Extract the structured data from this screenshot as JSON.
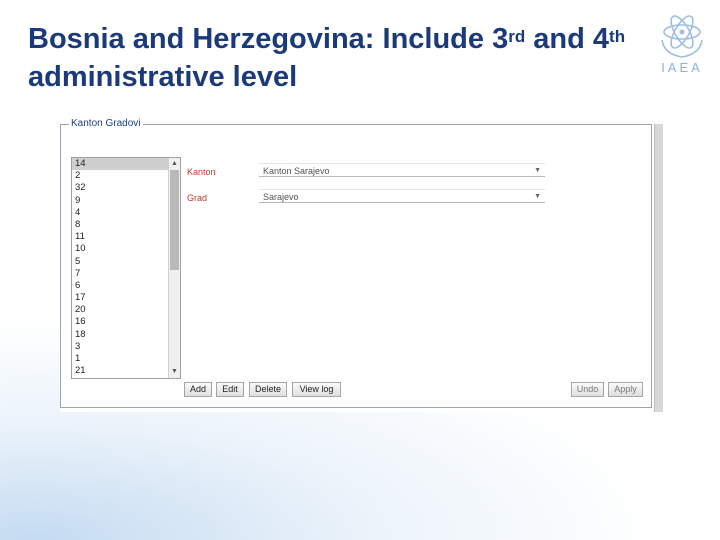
{
  "slide": {
    "title_prefix": "Bosnia and Herzegovina: Include 3",
    "title_sup1": "rd",
    "title_mid": " and 4",
    "title_sup2": "th",
    "title_suffix": " administrative level",
    "logo_text": "IAEA"
  },
  "panel": {
    "legend": "Kanton Gradovi",
    "list_items": [
      "14",
      "2",
      "32",
      "9",
      "4",
      "8",
      "11",
      "10",
      "5",
      "7",
      "6",
      "17",
      "20",
      "16",
      "18",
      "3",
      "1",
      "21"
    ],
    "selected_index": 0,
    "kanton_label": "Kanton",
    "kanton_value": "Kanton Sarajevo",
    "grad_label": "Grad",
    "grad_value": "Sarajevo",
    "buttons": {
      "add": "Add",
      "edit": "Edit",
      "delete": "Delete",
      "view_log": "View log",
      "undo": "Undo",
      "apply": "Apply"
    }
  },
  "colors": {
    "title": "#1b3a7a",
    "label": "#c0392b",
    "legend": "#1f3f7f"
  }
}
